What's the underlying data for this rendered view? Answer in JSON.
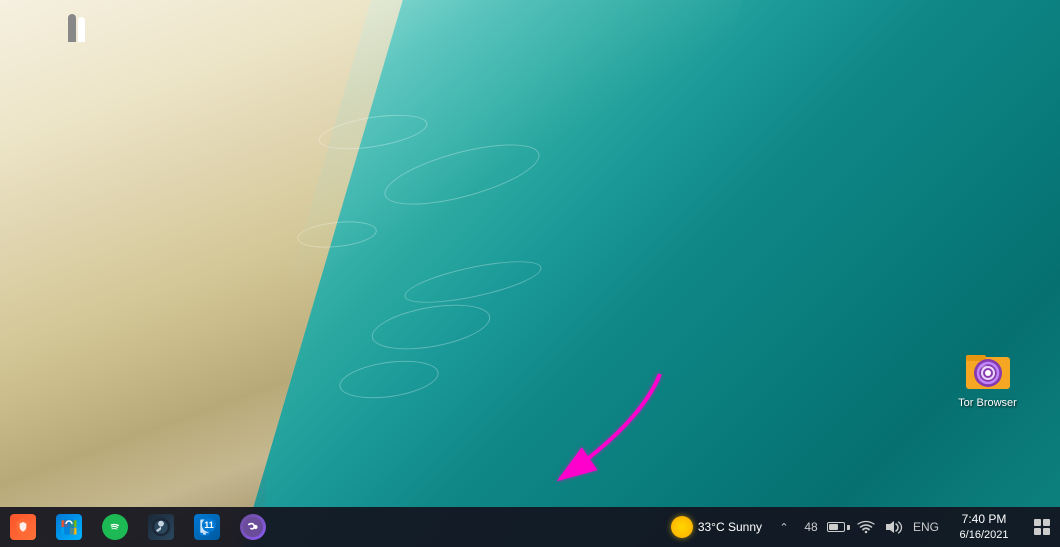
{
  "desktop": {
    "wallpaper_description": "Aerial beach scene with turquoise water and white sand"
  },
  "icons": {
    "tor_browser": {
      "label": "Tor Browser",
      "position": "top-right"
    }
  },
  "taskbar": {
    "apps": [
      {
        "name": "brave",
        "label": "Brave Browser",
        "color": "#ff6b35",
        "badge": null
      },
      {
        "name": "microsoft-store",
        "label": "Microsoft Store",
        "color": "#0078d4",
        "badge": null
      },
      {
        "name": "spotify",
        "label": "Spotify",
        "color": "#1db954",
        "badge": null
      },
      {
        "name": "steam",
        "label": "Steam",
        "color": "#1b2838",
        "badge": null
      },
      {
        "name": "phone-link",
        "label": "Phone Link",
        "color": "#0078d4",
        "badge": "11"
      },
      {
        "name": "purple-app",
        "label": "App",
        "color": "#6b4c9a",
        "badge": null
      }
    ],
    "weather": {
      "temperature": "33°C",
      "condition": "Sunny"
    },
    "tray": {
      "overflow_count": "",
      "battery_level": 70,
      "wifi_signal": 3,
      "volume": "on",
      "language": "ENG"
    },
    "clock": {
      "time": "7:40 PM",
      "date": "6/16/2021"
    }
  },
  "arrow": {
    "color": "#ff00cc",
    "direction": "down-left"
  }
}
